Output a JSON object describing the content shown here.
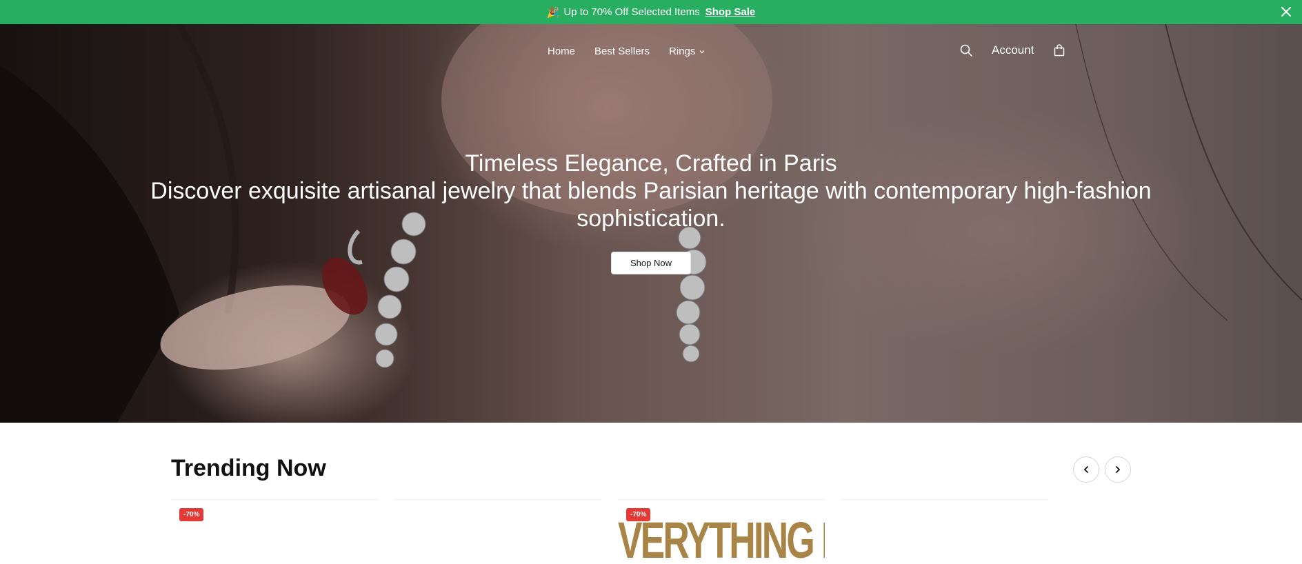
{
  "announcement": {
    "emoji": "🎉",
    "text": "Up to 70% Off Selected Items",
    "link": "Shop Sale",
    "background": "#27ae60"
  },
  "nav": {
    "items": [
      "Home",
      "Best Sellers",
      "Rings"
    ],
    "account": "Account",
    "icons": [
      "search-icon",
      "bag-icon",
      "chevron-down-icon"
    ]
  },
  "hero": {
    "title": "Timeless Elegance, Crafted in Paris",
    "subtitle": "Discover exquisite artisanal jewelry that blends Parisian heritage with contemporary high-fashion sophistication.",
    "cta": "Shop Now"
  },
  "trending": {
    "title": "Trending Now",
    "cards": [
      {
        "badge": "-70%",
        "art_text": ""
      },
      {
        "badge": "",
        "art_text": ""
      },
      {
        "badge": "-70%",
        "art_text": "VERYTHING BUT TH"
      },
      {
        "badge": "",
        "art_text": ""
      }
    ],
    "accent": "#e53935"
  }
}
